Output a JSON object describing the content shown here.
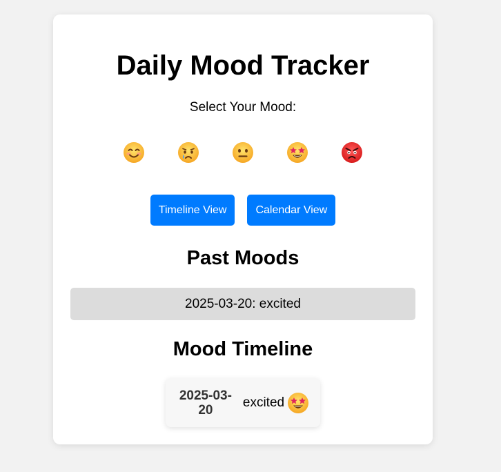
{
  "app": {
    "title": "Daily Mood Tracker",
    "select_label": "Select Your Mood:"
  },
  "moods": [
    {
      "name": "happy",
      "icon": "smiling-face-icon"
    },
    {
      "name": "sad",
      "icon": "crying-face-icon"
    },
    {
      "name": "neutral",
      "icon": "neutral-face-icon"
    },
    {
      "name": "excited",
      "icon": "star-struck-face-icon"
    },
    {
      "name": "angry",
      "icon": "angry-face-icon"
    }
  ],
  "views": {
    "timeline_label": "Timeline View",
    "calendar_label": "Calendar View"
  },
  "past": {
    "heading": "Past Moods",
    "items": [
      "2025-03-20: excited"
    ]
  },
  "timeline": {
    "heading": "Mood Timeline",
    "entries": [
      {
        "date": "2025-03-20",
        "mood": "excited",
        "icon": "star-struck-face-icon"
      }
    ]
  },
  "colors": {
    "accent": "#007bff",
    "page_bg": "#f2f2f2",
    "card_bg": "#ffffff",
    "list_item_bg": "#dcdcdc"
  }
}
